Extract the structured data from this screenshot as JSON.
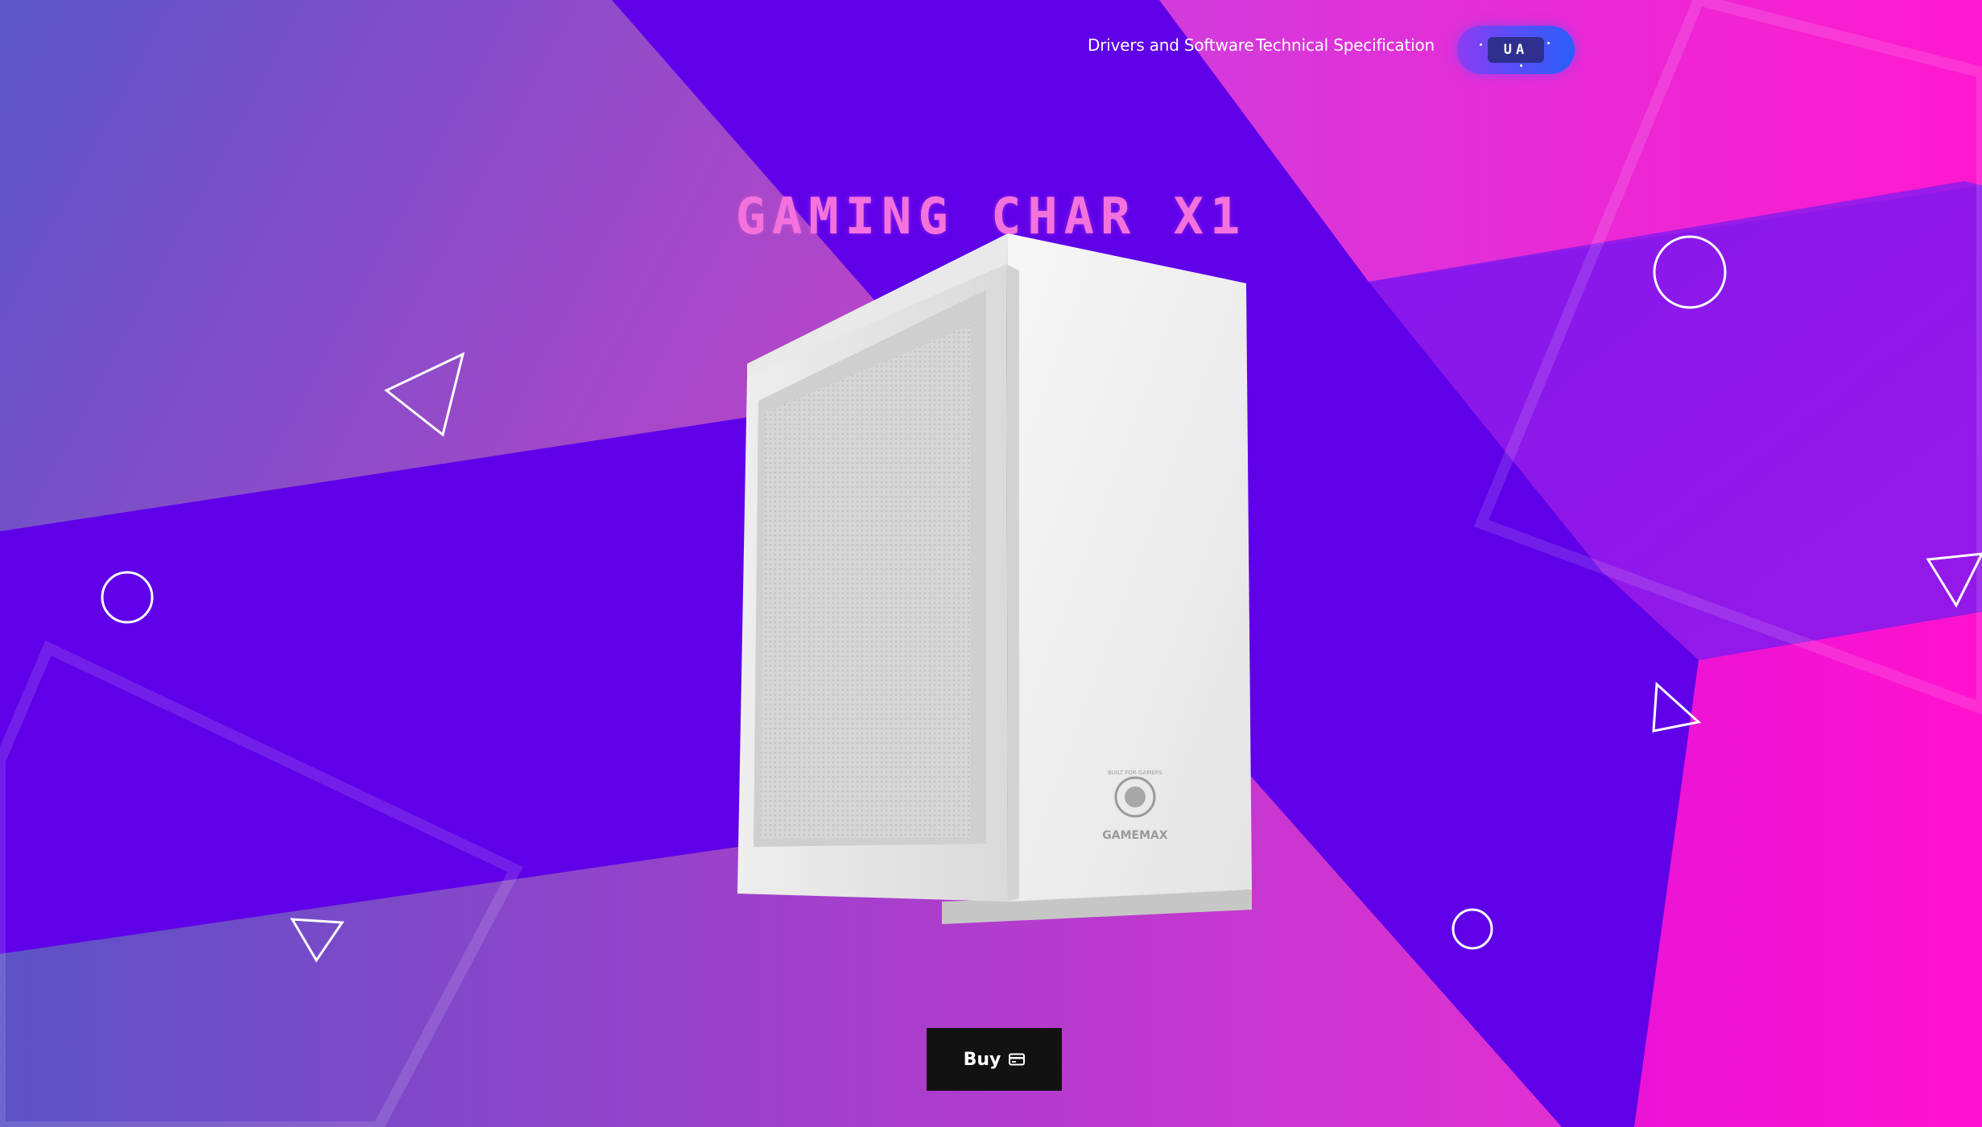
{
  "nav": {
    "links": [
      "Drivers and Software",
      "Technical Specification"
    ],
    "language_toggle": "UA"
  },
  "hero": {
    "title": "GAMING CHAR X1",
    "product_brand": "GAMEMAX",
    "product_tagline": "BUILT FOR GAMERS"
  },
  "actions": {
    "buy_label": "Buy",
    "buy_icon": "credit-card-icon"
  },
  "colors": {
    "background_purple": "#5f00e8",
    "accent_magenta": "#ff1fd0",
    "title_pink": "#f472dd",
    "button_dark": "#121212"
  }
}
